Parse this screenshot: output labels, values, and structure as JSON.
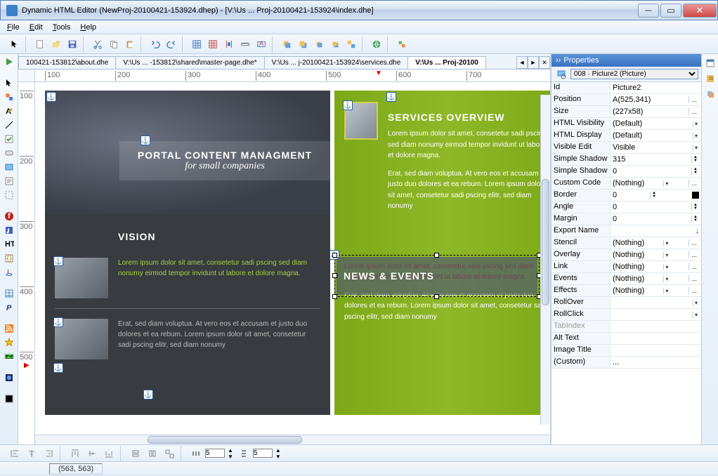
{
  "app": {
    "title": "Dynamic HTML Editor (NewProj-20100421-153924.dhep) - [V:\\Us ... Proj-20100421-153924\\index.dhe]"
  },
  "menu": {
    "file": "File",
    "edit": "Edit",
    "tools": "Tools",
    "help": "Help"
  },
  "tabs": [
    {
      "label": "100421-153812\\about.dhe",
      "active": false
    },
    {
      "label": "V:\\Us ... -153812\\shared\\master-page.dhe*",
      "active": false
    },
    {
      "label": "V:\\Us ... j-20100421-153924\\services.dhe",
      "active": false
    },
    {
      "label": "V:\\Us ... Proj-20100",
      "active": true
    }
  ],
  "ruler_h": [
    100,
    200,
    300,
    400,
    500,
    600,
    700
  ],
  "ruler_v": [
    100,
    200,
    300,
    400,
    500
  ],
  "hero": {
    "line1": "PORTAL CONTENT MANAGMENT",
    "line2": "for small companies"
  },
  "dark": {
    "vision_title": "VISION",
    "vision_lime": "Lorem ipsum dolor sit amet, consetetur sadi pscing sed diam nonumy eirmod tempor invidunt ut labore et dolore magna.",
    "vision_grey": "Erat, sed diam voluptua. At vero eos et accusam et justo duo dolores et ea rebum. Lorem ipsum dolor sit amet, consetetur sadi pscing elitr, sed diam nonumy"
  },
  "green": {
    "services_title": "SERVICES OVERVIEW",
    "p1": "Lorem ipsum dolor sit amet, consetetur sadi pscing sed diam nonumy eirmod tempor invidunt ut labore et dolore magna.",
    "p2": "Erat, sed diam voluptua. At vero eos et accusam et justo duo dolores et ea rebum. Lorem ipsum dolor sit amet, consetetur sadi pscing elitr, sed diam nonumy",
    "news_title": "NEWS & EVENTS",
    "red": "Lorem ipsum dolor sit amet, consetetur sadi pscing sed diam nonumy eirmod tempor invidunt ut labore et dolore magna.",
    "p3": "Erat, sed diam voluptua. At vero eos et accusam et justo duo dolores et ea rebum. Lorem ipsum dolor sit amet, consetetur sadi pscing elitr, sed diam nonumy"
  },
  "properties": {
    "title": "Properties",
    "combo": "008 · Picture2 (Picture)",
    "rows": [
      {
        "k": "Id",
        "v": "Picture2",
        "ctl": ""
      },
      {
        "k": "Position",
        "v": "A(525,341)",
        "ctl": "dots"
      },
      {
        "k": "Size",
        "v": "(227x58)",
        "ctl": "dots"
      },
      {
        "k": "HTML Visibility",
        "v": "(Default)",
        "ctl": "dd"
      },
      {
        "k": "HTML Display",
        "v": "(Default)",
        "ctl": "dd"
      },
      {
        "k": "Visible Edit",
        "v": "Visible",
        "ctl": "dd"
      },
      {
        "k": "Simple Shadow",
        "v": "315",
        "ctl": "spin"
      },
      {
        "k": "Simple Shadow",
        "v": "0",
        "ctl": "spin"
      },
      {
        "k": "Custom Code",
        "v": "(Nothing)",
        "ctl": "dd-dots"
      },
      {
        "k": "Border",
        "v": "0",
        "ctl": "spin-sw"
      },
      {
        "k": "Angle",
        "v": "0",
        "ctl": "spin"
      },
      {
        "k": "Margin",
        "v": "0",
        "ctl": "spin"
      },
      {
        "k": "Export Name",
        "v": "",
        "ctl": "warn"
      },
      {
        "k": "Stencil",
        "v": "(Nothing)",
        "ctl": "dd-dots"
      },
      {
        "k": "Overlay",
        "v": "(Nothing)",
        "ctl": "dd-dots"
      },
      {
        "k": "Link",
        "v": "(Nothing)",
        "ctl": "dd-dots"
      },
      {
        "k": "Events",
        "v": "(Nothing)",
        "ctl": "dd-dots"
      },
      {
        "k": "Effects",
        "v": "(Nothing)",
        "ctl": "dd-dots"
      },
      {
        "k": "RollOver",
        "v": "",
        "ctl": "dd"
      },
      {
        "k": "RollClick",
        "v": "",
        "ctl": "dd"
      },
      {
        "k": "TabIndex",
        "v": "",
        "ctl": "",
        "disabled": true
      },
      {
        "k": "Alt Text",
        "v": "",
        "ctl": ""
      },
      {
        "k": "Image Title",
        "v": "",
        "ctl": ""
      },
      {
        "k": "(Custom)",
        "v": "...",
        "ctl": ""
      }
    ]
  },
  "status": {
    "coords": "(563, 563)"
  },
  "align_inputs": [
    "5",
    "5"
  ]
}
